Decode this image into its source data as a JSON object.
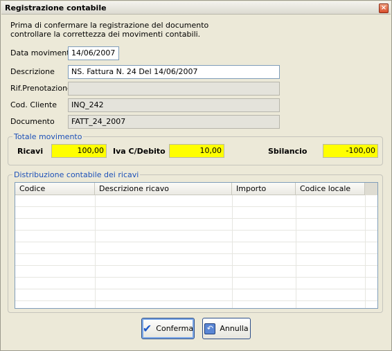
{
  "window": {
    "title": "Registrazione contabile",
    "close_symbol": "×"
  },
  "intro_text": "Prima di confermare la registrazione del documento controllare la correttezza dei movimenti contabili.",
  "form": {
    "data_movimento": {
      "label": "Data movimento",
      "value": "14/06/2007"
    },
    "descrizione": {
      "label": "Descrizione",
      "value": "NS. Fattura N. 24 Del 14/06/2007"
    },
    "rif_prenotazione": {
      "label": "Rif.Prenotazione",
      "value": ""
    },
    "cod_cliente": {
      "label": "Cod. Cliente",
      "value": "INQ_242"
    },
    "documento": {
      "label": "Documento",
      "value": "FATT_24_2007"
    }
  },
  "totale": {
    "legend": "Totale movimento",
    "ricavi_label": "Ricavi",
    "ricavi_value": "100,00",
    "iva_label": "Iva C/Debito",
    "iva_value": "10,00",
    "sbilancio_label": "Sbilancio",
    "sbilancio_value": "-100,00"
  },
  "distribuzione": {
    "legend": "Distribuzione contabile dei ricavi",
    "columns": [
      "Codice",
      "Descrizione ricavo",
      "Importo",
      "Codice locale"
    ],
    "rows": []
  },
  "buttons": {
    "conferma": "Conferma",
    "annulla": "Annulla"
  },
  "icons": {
    "conferma": "check-icon",
    "annulla": "undo-icon"
  },
  "colors": {
    "highlight_yellow": "#ffff00",
    "legend_blue": "#1c50b8"
  }
}
